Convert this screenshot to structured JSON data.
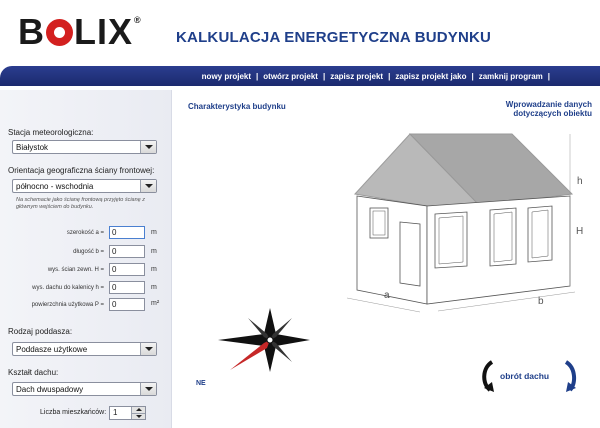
{
  "header": {
    "logo_text": "BOLIX",
    "title": "KALKULACJA ENERGETYCZNA BUDYNKU"
  },
  "menu": {
    "items": [
      "nowy projekt",
      "otwórz projekt",
      "zapisz projekt",
      "zapisz projekt jako",
      "zamknij program"
    ],
    "separator": "|"
  },
  "left_panel": {
    "title": "Wprowadzanie danych dotyczących obiektu",
    "station_label": "Stacja meteorologiczna:",
    "station_value": "Białystok",
    "orientation_label": "Orientacja geograficzna ściany frontowej:",
    "orientation_value": "północno - wschodnia",
    "orientation_note": "Na schemacie jako ścianę frontową przyjęto ścianę z głównym wejściem do budynku.",
    "fields": [
      {
        "label": "szerokość  a =",
        "value": "0",
        "unit": "m"
      },
      {
        "label": "długość  b =",
        "value": "0",
        "unit": "m"
      },
      {
        "label": "wys. ścian zewn.  H =",
        "value": "0",
        "unit": "m"
      },
      {
        "label": "wys. dachu do kalenicy  h =",
        "value": "0",
        "unit": "m"
      },
      {
        "label": "powierzchnia użytkowa  P =",
        "value": "0",
        "unit": "m²"
      }
    ],
    "attic_label": "Rodzaj poddasza:",
    "attic_value": "Poddasze użytkowe",
    "roof_label": "Kształt dachu:",
    "roof_value": "Dach dwuspadowy",
    "residents_label": "Liczba mieszkańców:",
    "residents_value": "1"
  },
  "main": {
    "section_title": "Charakterystyka budynku",
    "dim_h": "h",
    "dim_H": "H",
    "dim_a": "a",
    "dim_b": "b",
    "compass_label": "NE",
    "rotate_label": "obrót dachu"
  },
  "colors": {
    "brand_blue": "#1f3f8a",
    "menu_bar": "#233580",
    "logo_red": "#d3201f"
  }
}
